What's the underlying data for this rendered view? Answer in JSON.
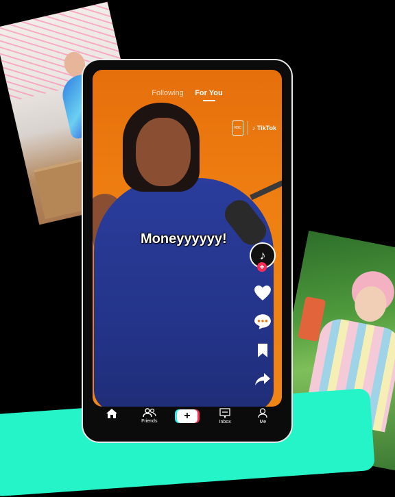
{
  "feed": {
    "tab_following": "Following",
    "tab_for_you": "For You",
    "caption": "Moneyyyyyy!",
    "brand_tiktok": "TikTok",
    "brand_rbc": "RBC"
  },
  "nav": {
    "home": "",
    "friends": "Friends",
    "create": "+",
    "inbox": "Inbox",
    "me": "Me"
  },
  "colors": {
    "accent_red": "#fe2c55",
    "accent_cyan": "#25f4ee",
    "swoosh": "#25f4c8",
    "video_bg": "#ef7f12"
  }
}
